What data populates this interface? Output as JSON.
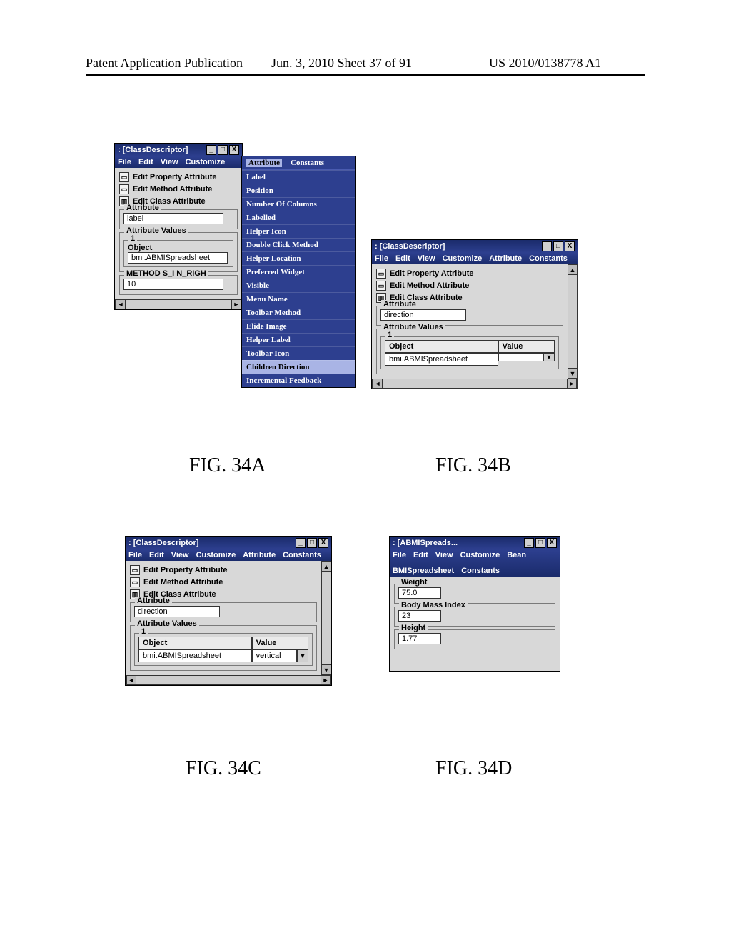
{
  "header": {
    "left": "Patent Application Publication",
    "middle": "Jun. 3, 2010   Sheet 37 of 91",
    "right": "US 2010/0138778 A1"
  },
  "labels": {
    "fig34a": "FIG. 34A",
    "fig34b": "FIG. 34B",
    "fig34c": "FIG. 34C",
    "fig34d": "FIG. 34D"
  },
  "winA": {
    "title": ": [ClassDescriptor]",
    "menus": [
      "File",
      "Edit",
      "View",
      "Customize"
    ],
    "actions": {
      "editProperty": "Edit Property Attribute",
      "editMethod": "Edit Method Attribute",
      "editClass": "Edit Class Attribute"
    },
    "attribute": {
      "label": "Attribute",
      "value": "label"
    },
    "attrValues": {
      "label": "Attribute Values",
      "sect1": "1",
      "objectHdr": "Object",
      "objectVal": "bmi.ABMISpreadsheet"
    },
    "methods": {
      "label": "METHOD S_I N_RIGH",
      "value": "10"
    },
    "dropdown": {
      "head": [
        "Attribute",
        "Constants"
      ],
      "items": [
        "Label",
        "Position",
        "Number Of Columns",
        "Labelled",
        "Helper Icon",
        "Double Click Method",
        "Helper Location",
        "Preferred Widget",
        "Visible",
        "Menu Name",
        "Toolbar Method",
        "Elide Image",
        "Helper Label",
        "Toolbar Icon",
        "Children Direction",
        "Incremental Feedback"
      ]
    }
  },
  "winB": {
    "title": ": [ClassDescriptor]",
    "menus": [
      "File",
      "Edit",
      "View",
      "Customize",
      "Attribute",
      "Constants"
    ],
    "actions": {
      "editProperty": "Edit Property Attribute",
      "editMethod": "Edit Method Attribute",
      "editClass": "Edit Class Attribute"
    },
    "attribute": {
      "label": "Attribute",
      "value": "direction"
    },
    "attrValues": {
      "label": "Attribute Values",
      "sect1": "1",
      "objectHdr": "Object",
      "valueHdr": "Value",
      "objectVal": "bmi.ABMISpreadsheet",
      "valueVal": ""
    }
  },
  "winC": {
    "title": ": [ClassDescriptor]",
    "menus": [
      "File",
      "Edit",
      "View",
      "Customize",
      "Attribute",
      "Constants"
    ],
    "actions": {
      "editProperty": "Edit Property Attribute",
      "editMethod": "Edit Method Attribute",
      "editClass": "Edit Class Attribute"
    },
    "attribute": {
      "label": "Attribute",
      "value": "direction"
    },
    "attrValues": {
      "label": "Attribute Values",
      "sect1": "1",
      "objectHdr": "Object",
      "valueHdr": "Value",
      "objectVal": "bmi.ABMISpreadsheet",
      "valueVal": "vertical"
    }
  },
  "winD": {
    "title": ": [ABMISpreads...",
    "menus": [
      "File",
      "Edit",
      "View",
      "Customize",
      "Bean",
      "BMISpreadsheet",
      "Constants"
    ],
    "weight": {
      "label": "Weight",
      "value": "75.0"
    },
    "bmi": {
      "label": "Body Mass Index",
      "value": "23"
    },
    "height": {
      "label": "Height",
      "value": "1.77"
    }
  },
  "glyphs": {
    "min": "_",
    "max": "□",
    "close": "X",
    "left": "◄",
    "right": "►",
    "up": "▲",
    "down": "▼"
  }
}
